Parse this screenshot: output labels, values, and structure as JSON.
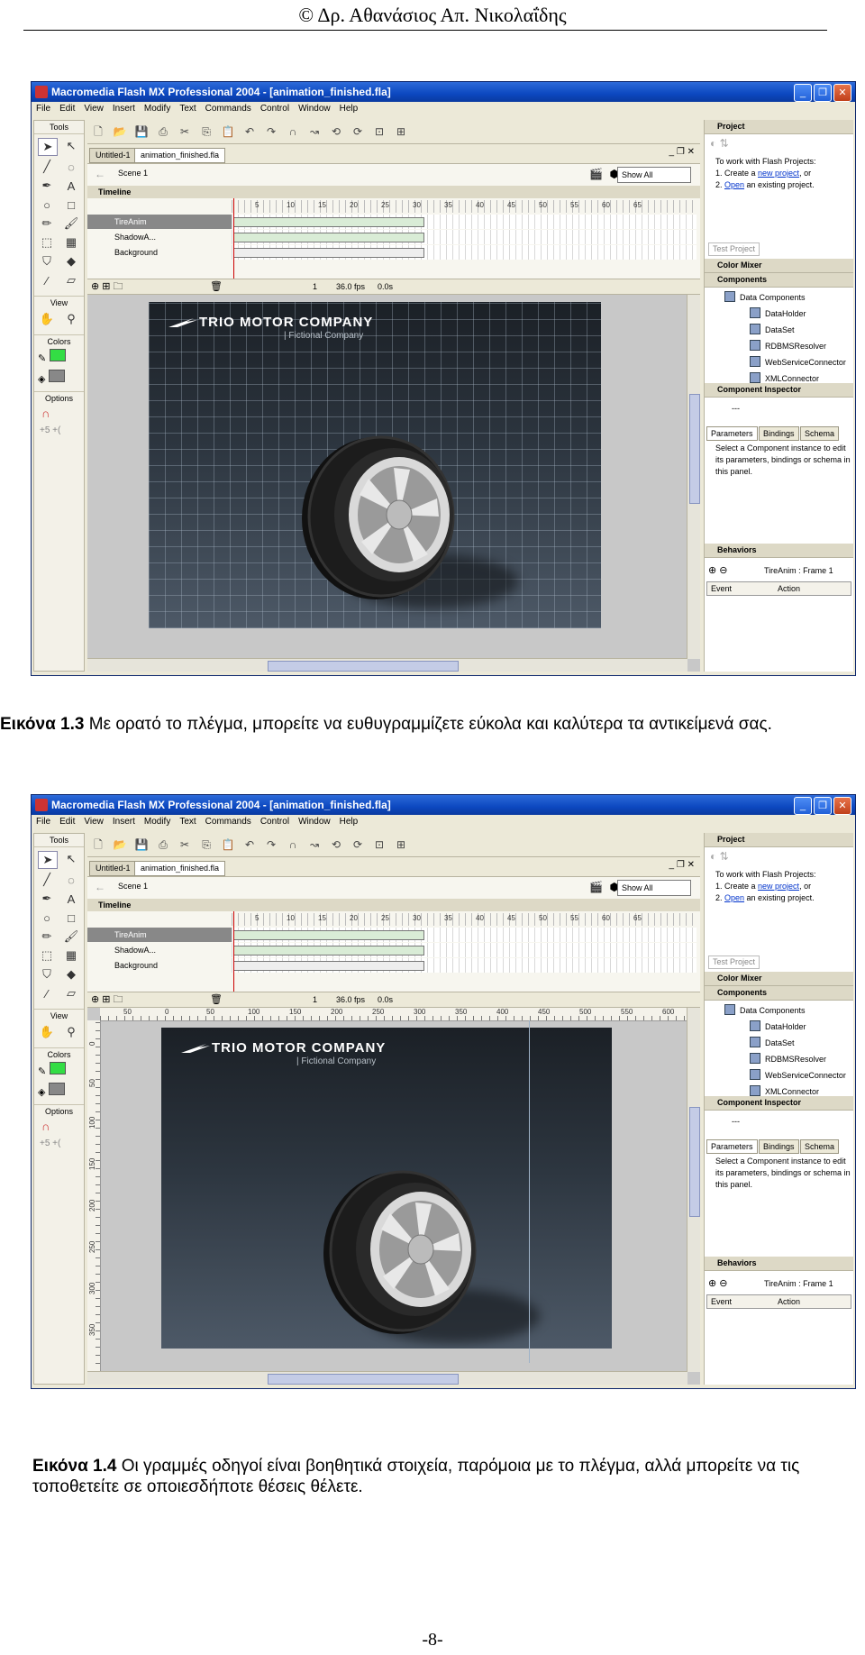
{
  "header": {
    "text": "© Δρ. Αθανάσιος Απ. Νικολαΐδης"
  },
  "window": {
    "title": "Macromedia Flash MX Professional 2004 - [animation_finished.fla]",
    "menu": [
      "File",
      "Edit",
      "View",
      "Insert",
      "Modify",
      "Text",
      "Commands",
      "Control",
      "Window",
      "Help"
    ],
    "tools_title": "Tools",
    "view_label": "View",
    "colors_label": "Colors",
    "options_label": "Options",
    "doc_tabs": [
      "Untitled-1",
      "animation_finished.fla"
    ],
    "scene": "Scene 1",
    "zoom": "Show All",
    "timeline_title": "Timeline",
    "frame_numbers": [
      "5",
      "10",
      "15",
      "20",
      "25",
      "30",
      "35",
      "40",
      "45",
      "50",
      "55",
      "60",
      "65"
    ],
    "layers": [
      "TireAnim",
      "ShadowA...",
      "Background"
    ],
    "frame_current": "1",
    "fps": "36.0 fps",
    "time": "0.0s",
    "company": "TRIO MOTOR COMPANY",
    "tagline": "| Fictional Company",
    "panels": {
      "project": "Project",
      "project_lines": [
        "To work with Flash Projects:",
        "1. Create a ",
        "new project",
        ", or",
        "2. ",
        "Open",
        " an existing project."
      ],
      "test_project": "Test Project",
      "color_mixer": "Color Mixer",
      "components": "Components",
      "components_items": [
        "Data Components",
        "DataHolder",
        "DataSet",
        "RDBMSResolver",
        "WebServiceConnector",
        "XMLConnector"
      ],
      "component_inspector": "Component Inspector",
      "inspector_value": "---",
      "inspector_tabs": [
        "Parameters",
        "Bindings",
        "Schema"
      ],
      "inspector_text": "Select a Component instance to edit its parameters, bindings or schema in this panel.",
      "behaviors": "Behaviors",
      "behaviors_target": "TireAnim : Frame 1",
      "behaviors_cols": [
        "Event",
        "Action"
      ]
    },
    "ruler_h": [
      "50",
      "0",
      "50",
      "100",
      "150",
      "200",
      "250",
      "300",
      "350",
      "400",
      "450",
      "500",
      "550",
      "600"
    ],
    "ruler_v": [
      "0",
      "50",
      "100",
      "150",
      "200",
      "250",
      "300",
      "350"
    ]
  },
  "captions": {
    "fig1_label": "Εικόνα 1.3",
    "fig1_text": " Με ορατό το πλέγμα, μπορείτε να ευθυγραμμίζετε εύκολα και καλύτερα τα αντικείμενά σας.",
    "fig2_label": "Εικόνα 1.4",
    "fig2_text": " Οι γραμμές οδηγοί είναι βοηθητικά στοιχεία, παρόμοια με το πλέγμα, αλλά μπορείτε να τις τοποθετείτε σε οποιεσδήποτε θέσεις θέλετε."
  },
  "page_number": "-8-"
}
